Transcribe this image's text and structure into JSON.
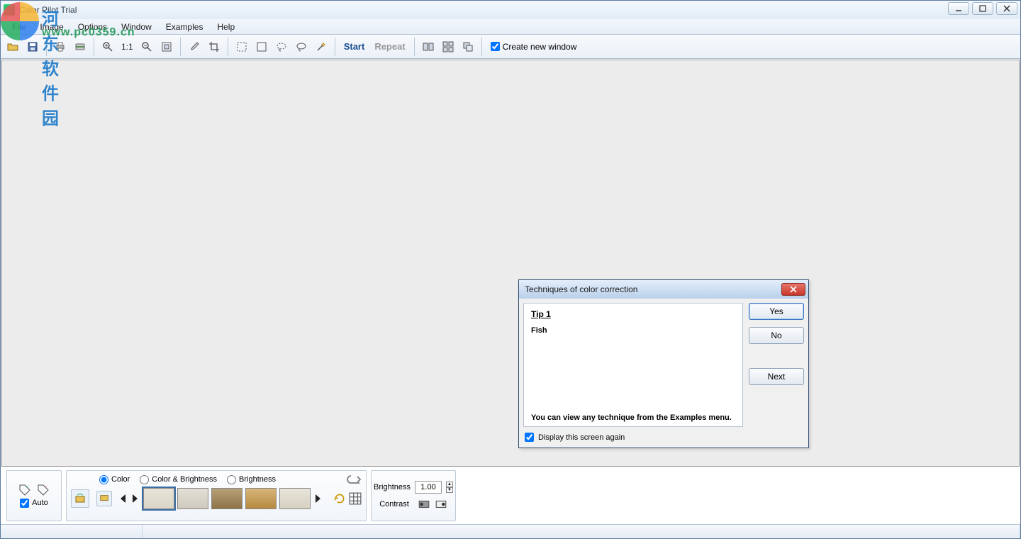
{
  "window": {
    "title": "Color Pilot Trial"
  },
  "menus": {
    "file": "File",
    "image": "Image",
    "options": "Options",
    "window": "Window",
    "examples": "Examples",
    "help": "Help"
  },
  "toolbar": {
    "zoom_ratio": "1:1",
    "start": "Start",
    "repeat": "Repeat",
    "create_new_window": "Create new window"
  },
  "bottom": {
    "auto": "Auto",
    "color": "Color",
    "color_brightness": "Color & Brightness",
    "brightness": "Brightness",
    "brightness_label": "Brightness",
    "brightness_value": "1.00",
    "contrast_label": "Contrast"
  },
  "dialog": {
    "title": "Techniques of color correction",
    "tip": "Tip 1",
    "subject": "Fish",
    "note": "You can view any technique from the Examples menu.",
    "yes": "Yes",
    "no": "No",
    "next": "Next",
    "display_again": "Display this screen again"
  },
  "watermark": {
    "cn": "河东软件园",
    "url": "www.pc0359.cn"
  }
}
